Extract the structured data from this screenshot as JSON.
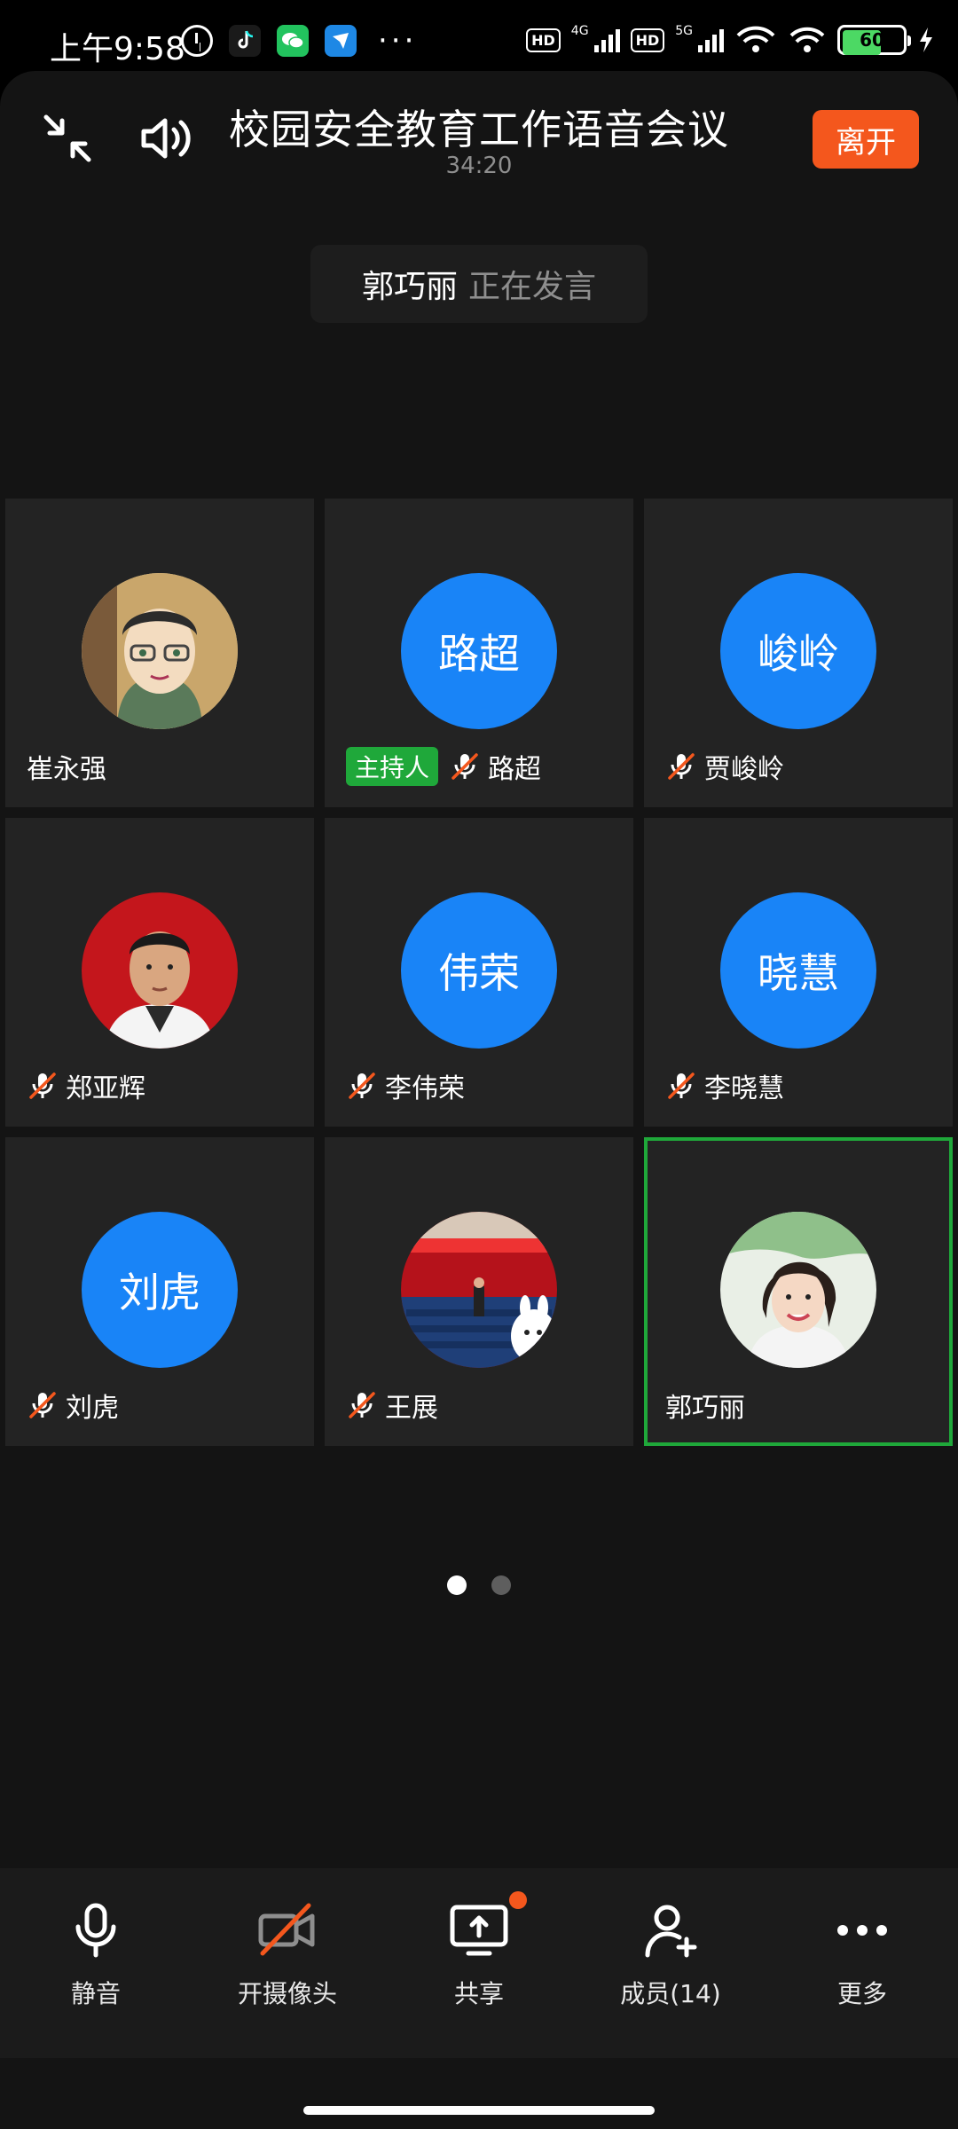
{
  "status_bar": {
    "time": "上午9:58",
    "battery_level": "60",
    "network_4g": "4G",
    "network_5g": "5G",
    "hd": "HD",
    "more": "···"
  },
  "meeting": {
    "title": "校园安全教育工作语音会议",
    "duration": "34:20",
    "leave_label": "离开",
    "speaking_name": "郭巧丽",
    "speaking_status": "正在发言"
  },
  "participants": [
    {
      "name": "崔永强",
      "avatar_type": "photo",
      "avatar_text": "",
      "muted": false,
      "host": false,
      "active": false
    },
    {
      "name": "路超",
      "avatar_type": "text",
      "avatar_text": "路超",
      "muted": true,
      "host": true,
      "active": false
    },
    {
      "name": "贾峻岭",
      "avatar_type": "text",
      "avatar_text": "峻岭",
      "muted": true,
      "host": false,
      "active": false
    },
    {
      "name": "郑亚辉",
      "avatar_type": "photo",
      "avatar_text": "",
      "muted": true,
      "host": false,
      "active": false
    },
    {
      "name": "李伟荣",
      "avatar_type": "text",
      "avatar_text": "伟荣",
      "muted": true,
      "host": false,
      "active": false
    },
    {
      "name": "李晓慧",
      "avatar_type": "text",
      "avatar_text": "晓慧",
      "muted": true,
      "host": false,
      "active": false
    },
    {
      "name": "刘虎",
      "avatar_type": "text",
      "avatar_text": "刘虎",
      "muted": true,
      "host": false,
      "active": false
    },
    {
      "name": "王展",
      "avatar_type": "photo",
      "avatar_text": "",
      "muted": true,
      "host": false,
      "active": false
    },
    {
      "name": "郭巧丽",
      "avatar_type": "photo",
      "avatar_text": "",
      "muted": false,
      "host": false,
      "active": true
    }
  ],
  "host_badge": "主持人",
  "pagination": {
    "total": 2,
    "current": 1
  },
  "toolbar": {
    "mute_label": "静音",
    "camera_label": "开摄像头",
    "share_label": "共享",
    "members_label": "成员(14)",
    "more_label": "更多"
  },
  "colors": {
    "accent_blue": "#1984f7",
    "leave_orange": "#f4571d",
    "host_green": "#1fa83a",
    "background": "#141414"
  }
}
